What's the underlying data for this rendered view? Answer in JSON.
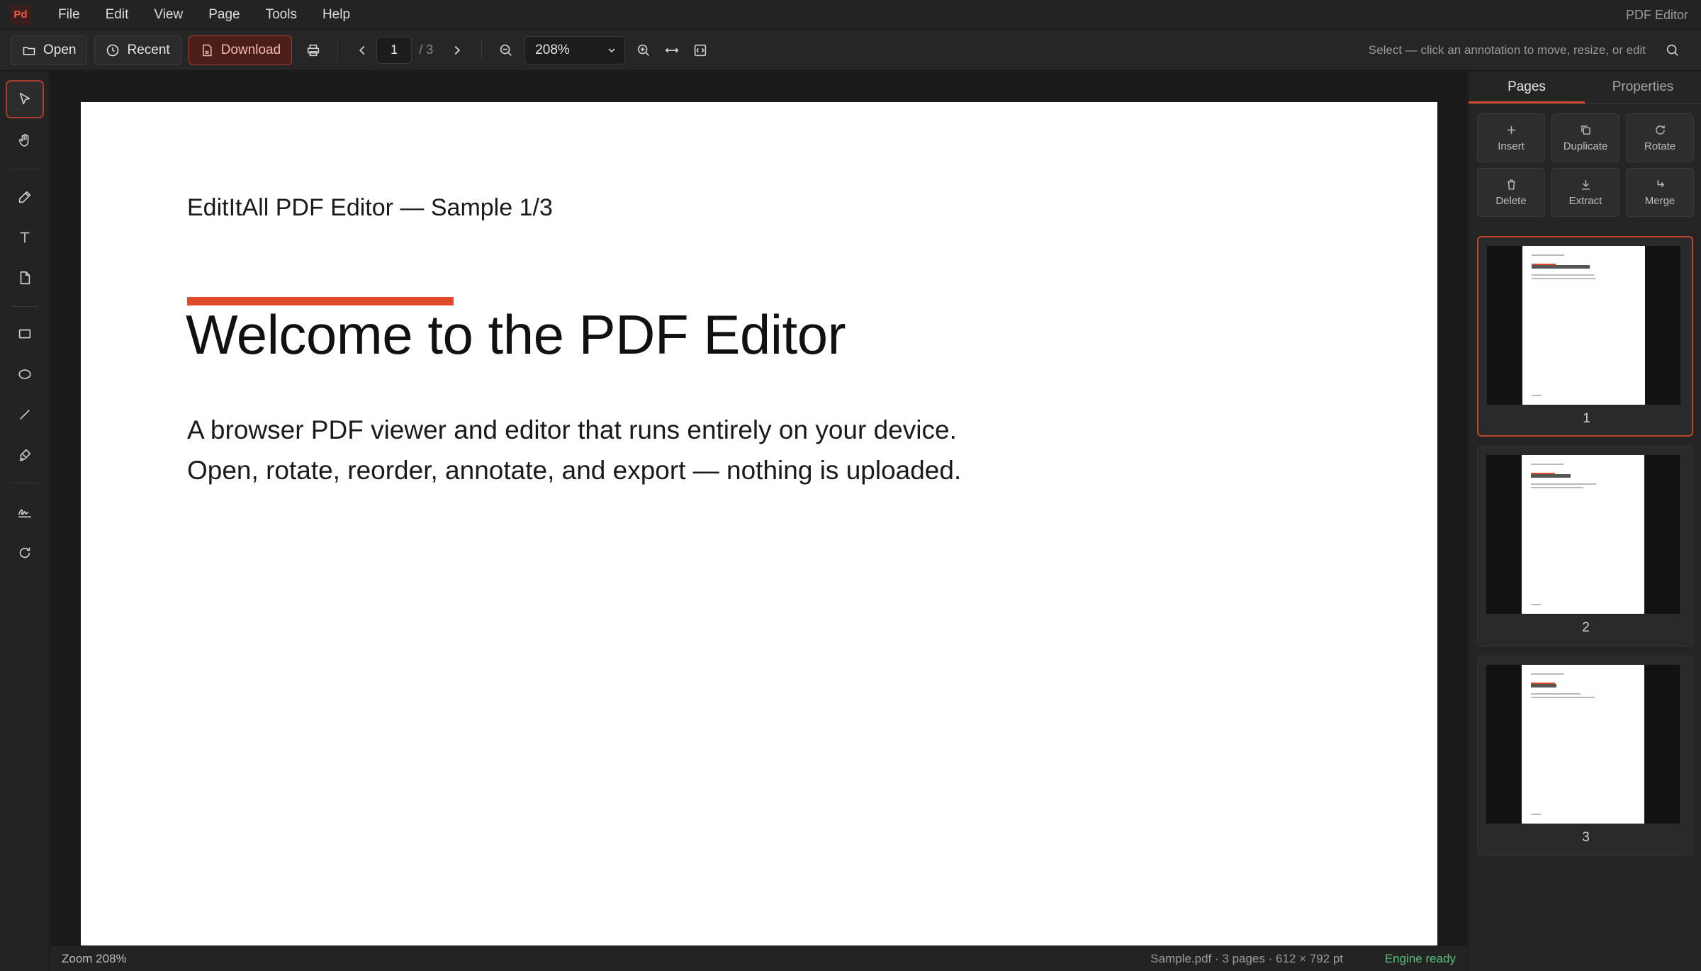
{
  "app": {
    "logo_text": "Pd",
    "title": "PDF Editor"
  },
  "menu": [
    "File",
    "Edit",
    "View",
    "Page",
    "Tools",
    "Help"
  ],
  "toolbar": {
    "open_label": "Open",
    "recent_label": "Recent",
    "download_label": "Download",
    "page_current": "1",
    "page_total": "/ 3",
    "zoom_value": "208%",
    "hint": "Select — click an annotation to move, resize, or edit"
  },
  "rail_tools": [
    "select-tool",
    "hand-tool",
    "pen-tool",
    "text-tool",
    "note-tool",
    "rectangle-tool",
    "ellipse-tool",
    "line-tool",
    "highlighter-tool",
    "signature-tool",
    "rotate-tool"
  ],
  "document": {
    "header": "EditItAll PDF Editor — Sample 1/3",
    "title": "Welcome to the PDF Editor",
    "body_line1": "A browser PDF viewer and editor that runs entirely on your device.",
    "body_line2": "Open, rotate, reorder, annotate, and export — nothing is uploaded.",
    "accent_color": "#e04a2a"
  },
  "sidebar": {
    "tabs": [
      "Pages",
      "Properties"
    ],
    "actions": [
      "Insert",
      "Duplicate",
      "Rotate",
      "Delete",
      "Extract",
      "Merge"
    ],
    "pages": [
      {
        "number": "1",
        "selected": true
      },
      {
        "number": "2",
        "selected": false
      },
      {
        "number": "3",
        "selected": false
      }
    ]
  },
  "status": {
    "zoom": "Zoom 208%",
    "file_info": "Sample.pdf · 3 pages · 612 × 792 pt",
    "engine": "Engine ready",
    "engine_color": "#55c07a"
  }
}
